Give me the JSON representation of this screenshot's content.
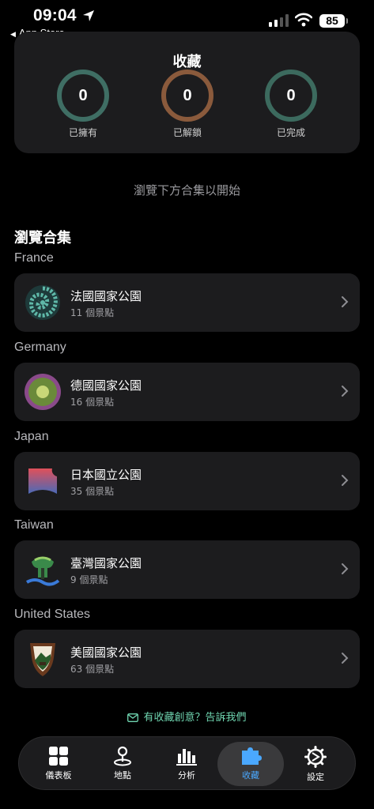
{
  "status_bar": {
    "time": "09:04",
    "back_app": "App Store",
    "battery": "85"
  },
  "collection": {
    "title": "收藏",
    "stats": [
      {
        "value": "0",
        "label": "已擁有",
        "color": "#3f6e64"
      },
      {
        "value": "0",
        "label": "已解鎖",
        "color": "#8a5a3c"
      },
      {
        "value": "0",
        "label": "已完成",
        "color": "#3c6a5e"
      }
    ]
  },
  "browse_hint": "瀏覽下方合集以開始",
  "browse_section": {
    "title": "瀏覽合集",
    "groups": [
      {
        "country": "France",
        "name": "法國國家公園",
        "count": "11 個景點",
        "icon": "france-parks-logo"
      },
      {
        "country": "Germany",
        "name": "德國國家公園",
        "count": "16 個景點",
        "icon": "germany-parks-logo"
      },
      {
        "country": "Japan",
        "name": "日本國立公園",
        "count": "35 個景點",
        "icon": "japan-parks-logo"
      },
      {
        "country": "Taiwan",
        "name": "臺灣國家公園",
        "count": "9 個景點",
        "icon": "taiwan-parks-logo"
      },
      {
        "country": "United States",
        "name": "美國國家公園",
        "count": "63 個景點",
        "icon": "us-nps-logo"
      }
    ]
  },
  "feedback": "有收藏創意？告訴我們",
  "tabs": [
    {
      "label": "儀表板",
      "icon": "dashboard-icon",
      "active": false
    },
    {
      "label": "地點",
      "icon": "location-pin-icon",
      "active": false
    },
    {
      "label": "分析",
      "icon": "chart-icon",
      "active": false
    },
    {
      "label": "收藏",
      "icon": "puzzle-icon",
      "active": true
    },
    {
      "label": "設定",
      "icon": "gear-icon",
      "active": false
    }
  ],
  "colors": {
    "accent": "#4aa8ff",
    "feedback": "#6fd5b0",
    "card": "#1c1c1e"
  }
}
